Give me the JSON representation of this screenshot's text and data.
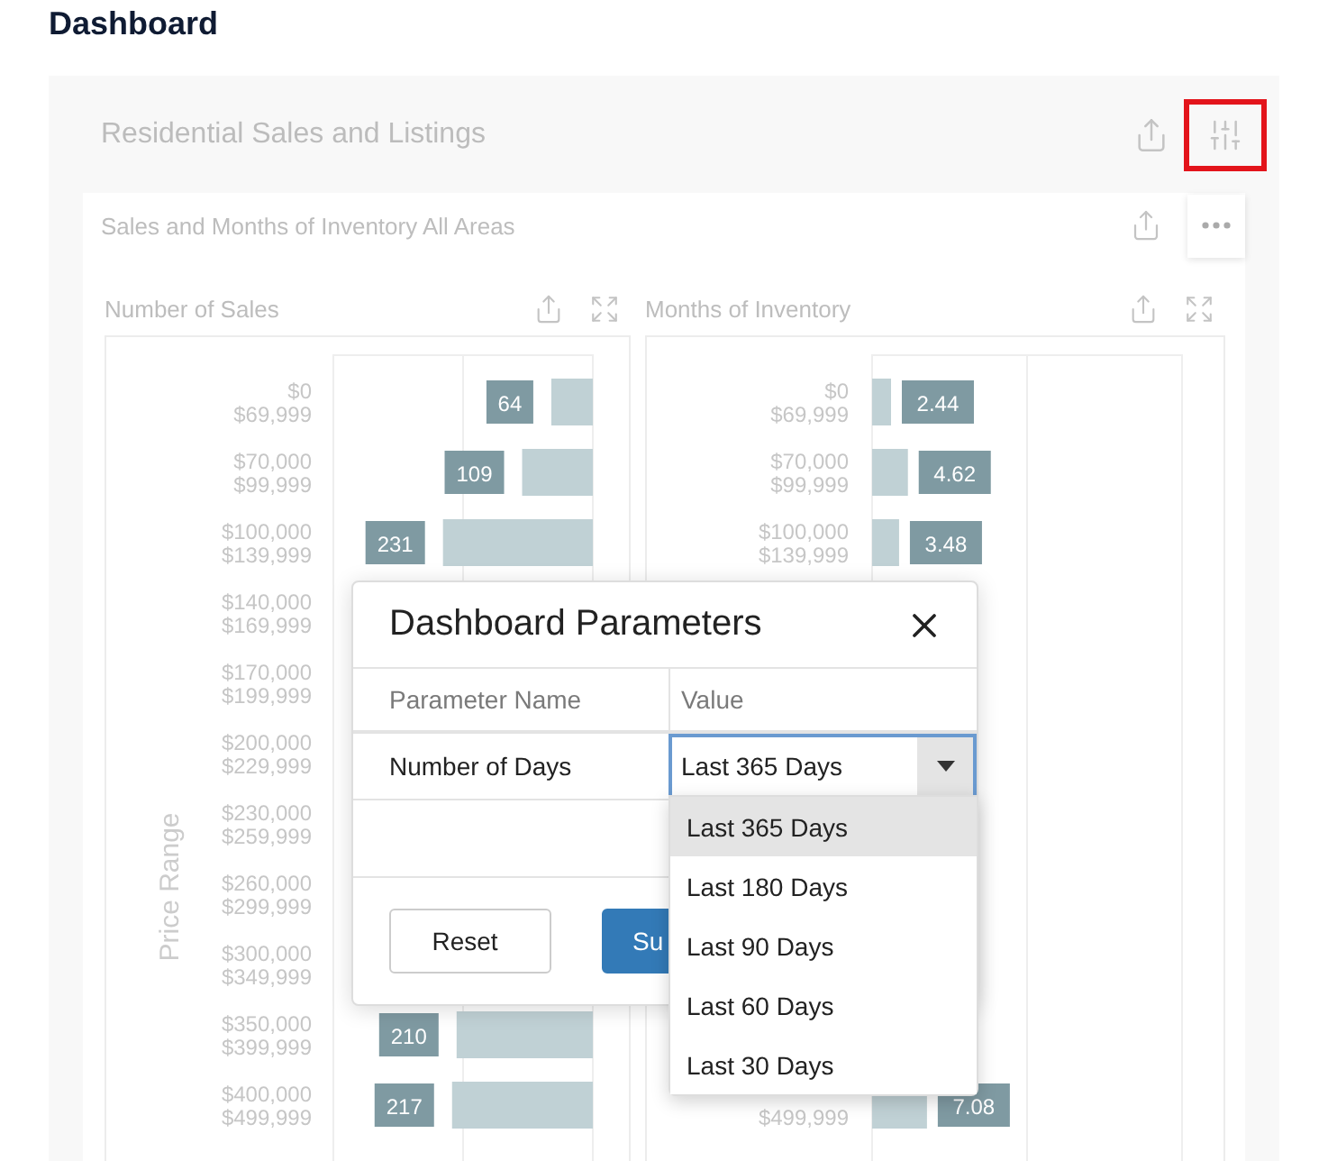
{
  "page_title": "Dashboard",
  "panel": {
    "title": "Residential Sales and Listings",
    "settings_highlighted": true
  },
  "card": {
    "title": "Sales and Months of Inventory All Areas"
  },
  "charts": [
    {
      "title": "Number of Sales",
      "chart_data": {
        "type": "bar",
        "orientation": "horizontal",
        "ylabel": "Price Range",
        "categories": [
          "$0\n$69,999",
          "$70,000\n$99,999",
          "$100,000\n$139,999",
          "$140,000\n$169,999",
          "$170,000\n$199,999",
          "$200,000\n$229,999",
          "$230,000\n$259,999",
          "$260,000\n$299,999",
          "$300,000\n$349,999",
          "$350,000\n$399,999",
          "$400,000\n$499,999"
        ],
        "series": [
          {
            "color": "#c0d1d5",
            "values": [
              64,
              109,
              231,
              null,
              null,
              null,
              null,
              null,
              null,
              210,
              217
            ]
          }
        ],
        "xlim": [
          400,
          0
        ],
        "data_labels": true
      }
    },
    {
      "title": "Months of Inventory",
      "chart_data": {
        "type": "bar",
        "orientation": "horizontal",
        "categories": [
          "$0\n$69,999",
          "$70,000\n$99,999",
          "$100,000\n$139,999",
          null,
          null,
          null,
          null,
          null,
          null,
          null,
          "$499,999"
        ],
        "series": [
          {
            "color": "#c0d1d5",
            "values": [
              2.44,
              4.62,
              3.48,
              null,
              null,
              null,
              null,
              null,
              null,
              null,
              7.08
            ]
          }
        ],
        "xlim": [
          0,
          40
        ],
        "data_labels": true
      }
    }
  ],
  "dialog": {
    "title": "Dashboard Parameters",
    "columns": [
      "Parameter Name",
      "Value"
    ],
    "rows": [
      {
        "name": "Number of Days",
        "value": "Last 365 Days"
      }
    ],
    "buttons": [
      {
        "label": "Reset",
        "kind": "secondary"
      },
      {
        "label": "Su",
        "kind": "primary"
      }
    ],
    "dropdown": {
      "options": [
        {
          "label": "Last 365 Days",
          "selected": true
        },
        {
          "label": "Last 180 Days",
          "selected": false
        },
        {
          "label": "Last 90 Days",
          "selected": false
        },
        {
          "label": "Last 60 Days",
          "selected": false
        },
        {
          "label": "Last 30 Days",
          "selected": false
        }
      ]
    }
  }
}
